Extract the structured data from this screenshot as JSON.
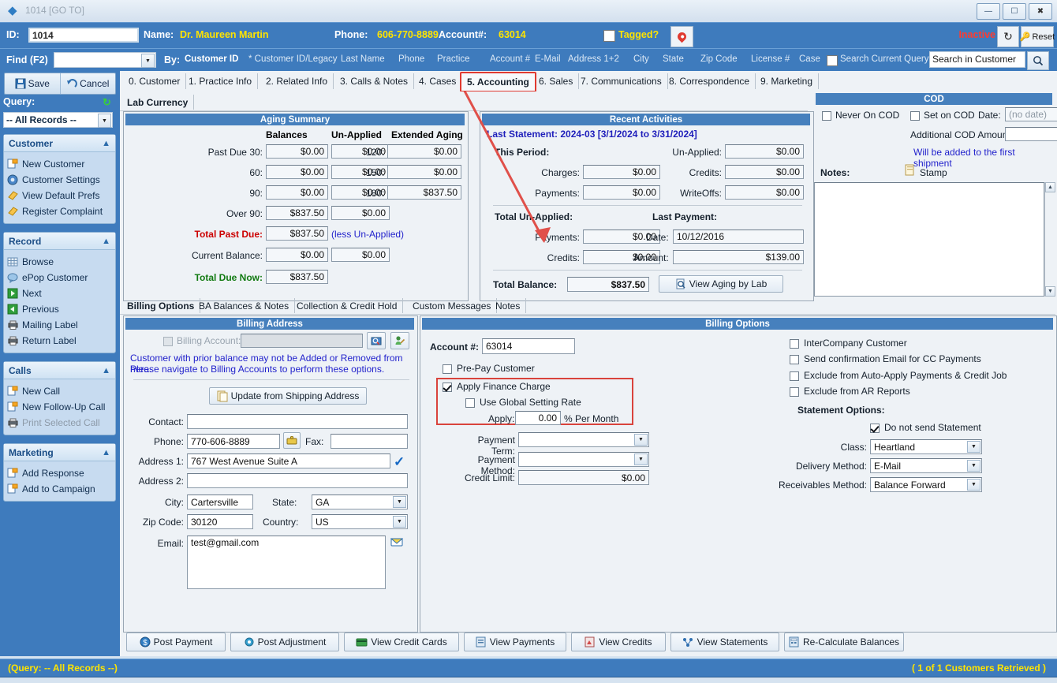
{
  "window": {
    "title": "1014 [GO TO]",
    "minimize": "—",
    "maximize": "❐",
    "close": "✕"
  },
  "header": {
    "id_label": "ID:",
    "id_value": "1014",
    "name_label": "Name:",
    "name_value": "Dr. Maureen Martin",
    "phone_label": "Phone:",
    "phone_value": "606-770-8889",
    "account_label": "Account#:",
    "account_value": "63014",
    "tagged_label": "Tagged?",
    "status": "Inactive",
    "reset_label": "Reset"
  },
  "findbar": {
    "find_label": "Find (F2)",
    "find_value": "",
    "by_label": "By:",
    "by_items": [
      {
        "label": "Customer ID",
        "current": true
      },
      {
        "label": "* Customer ID/Legacy",
        "current": false
      },
      {
        "label": "Last Name",
        "current": false
      },
      {
        "label": "Phone",
        "current": false
      },
      {
        "label": "Practice",
        "current": false
      },
      {
        "label": "Account #",
        "current": false
      },
      {
        "label": "E-Mail",
        "current": false
      },
      {
        "label": "Address 1+2",
        "current": false
      },
      {
        "label": "City",
        "current": false
      },
      {
        "label": "State",
        "current": false
      },
      {
        "label": "Zip Code",
        "current": false
      },
      {
        "label": "License #",
        "current": false
      },
      {
        "label": "Case",
        "current": false
      }
    ],
    "search_current_query": "Search Current Query",
    "search_value": "Search in Customer"
  },
  "sidebar": {
    "save_label": "Save",
    "cancel_label": "Cancel",
    "query_label": "Query:",
    "query_value": "-- All Records --",
    "groups": [
      {
        "title": "Customer",
        "items": [
          {
            "label": "New Customer",
            "icon": "new-document-icon",
            "disabled": false
          },
          {
            "label": "Customer Settings",
            "icon": "gear-ball-icon",
            "disabled": false
          },
          {
            "label": "View Default Prefs",
            "icon": "prefs-icon",
            "disabled": false
          },
          {
            "label": "Register Complaint",
            "icon": "prefs-icon",
            "disabled": false
          }
        ]
      },
      {
        "title": "Record",
        "items": [
          {
            "label": "Browse",
            "icon": "grid-icon",
            "disabled": false
          },
          {
            "label": "ePop Customer",
            "icon": "bubble-icon",
            "disabled": false
          },
          {
            "label": "Next",
            "icon": "next-icon",
            "disabled": false
          },
          {
            "label": "Previous",
            "icon": "previous-icon",
            "disabled": false
          },
          {
            "label": "Mailing Label",
            "icon": "printer-icon",
            "disabled": false
          },
          {
            "label": "Return Label",
            "icon": "printer-icon",
            "disabled": false
          }
        ]
      },
      {
        "title": "Calls",
        "items": [
          {
            "label": "New Call",
            "icon": "new-document-icon",
            "disabled": false
          },
          {
            "label": "New Follow-Up Call",
            "icon": "new-document-icon",
            "disabled": false
          },
          {
            "label": "Print Selected Call",
            "icon": "printer-icon",
            "disabled": true
          }
        ]
      },
      {
        "title": "Marketing",
        "items": [
          {
            "label": "Add Response",
            "icon": "new-document-icon",
            "disabled": false
          },
          {
            "label": "Add to Campaign",
            "icon": "new-document-icon",
            "disabled": false
          }
        ]
      }
    ]
  },
  "main_tabs": [
    {
      "label": "0. Customer",
      "active": false
    },
    {
      "label": "1. Practice Info",
      "active": false
    },
    {
      "label": "2. Related Info",
      "active": false
    },
    {
      "label": "3. Calls & Notes",
      "active": false
    },
    {
      "label": "4. Cases",
      "active": false
    },
    {
      "label": "5. Accounting",
      "active": true
    },
    {
      "label": "6. Sales",
      "active": false
    },
    {
      "label": "7. Communications",
      "active": false
    },
    {
      "label": "8. Correspondence",
      "active": false
    },
    {
      "label": "9. Marketing",
      "active": false
    }
  ],
  "currency_tabs": [
    {
      "label": "Lab Currency",
      "active": true
    }
  ],
  "aging": {
    "title": "Aging Summary",
    "col_balances": "Balances",
    "col_unapplied": "Un-Applied",
    "col_extended": "Extended Aging",
    "rows": [
      {
        "label": "Past Due 30:",
        "balance": "$0.00",
        "unapplied": "$0.00"
      },
      {
        "label": "60:",
        "balance": "$0.00",
        "unapplied": "$0.00"
      },
      {
        "label": "90:",
        "balance": "$0.00",
        "unapplied": "$0.00"
      },
      {
        "label": "Over 90:",
        "balance": "$837.50",
        "unapplied": "$0.00"
      }
    ],
    "extended_rows": [
      {
        "label": "120:",
        "value": "$0.00"
      },
      {
        "label": "150:",
        "value": "$0.00"
      },
      {
        "label": "180:",
        "value": "$837.50"
      }
    ],
    "total_past_due_label": "Total Past Due:",
    "total_past_due_value": "$837.50",
    "less_unapplied": "(less Un-Applied)",
    "current_balance_label": "Current Balance:",
    "current_balance_value": "$0.00",
    "current_balance_unapplied": "$0.00",
    "total_due_now_label": "Total Due Now:",
    "total_due_now_value": "$837.50"
  },
  "recent": {
    "title": "Recent Activities",
    "last_statement": "Last Statement: 2024-03  [3/1/2024 to 3/31/2024]",
    "this_period_label": "This Period:",
    "charges_label": "Charges:",
    "charges_value": "$0.00",
    "payments_label": "Payments:",
    "payments_value": "$0.00",
    "unapplied_label": "Un-Applied:",
    "unapplied_value": "$0.00",
    "credits_label": "Credits:",
    "credits_value": "$0.00",
    "writeoffs_label": "WriteOffs:",
    "writeoffs_value": "$0.00",
    "total_unapplied_label": "Total Un-Applied:",
    "tu_payments_label": "Payments:",
    "tu_payments_value": "$0.00",
    "tu_credits_label": "Credits:",
    "tu_credits_value": "$0.00",
    "last_payment_label": "Last Payment:",
    "lp_date_label": "Date:",
    "lp_date_value": "10/12/2016",
    "lp_amount_label": "Amount:",
    "lp_amount_value": "$139.00",
    "total_balance_label": "Total Balance:",
    "total_balance_value": "$837.50",
    "view_aging_btn": "View Aging by Lab"
  },
  "cod": {
    "title": "COD",
    "never_on_cod": "Never On COD",
    "set_on_cod": "Set on COD",
    "date_label": "Date:",
    "date_value": "(no date)",
    "additional_label": "Additional COD Amount:",
    "additional_value": "",
    "note": "Will be added to the first shipment",
    "notes_label": "Notes:",
    "stamp_label": "Stamp",
    "notes_value": ""
  },
  "billing_tabs": [
    {
      "label": "Billing Options",
      "active": true
    },
    {
      "label": "BA Balances & Notes",
      "active": false
    },
    {
      "label": "Collection & Credit Hold",
      "active": false
    },
    {
      "label": "Custom Messages",
      "active": false
    },
    {
      "label": "Notes",
      "active": false
    }
  ],
  "billing_address": {
    "title": "Billing Address",
    "billing_account_label": "Billing Account:",
    "billing_account_value": "",
    "warning_line1": "Customer with prior balance may not be Added or Removed from here.",
    "warning_line2": "Please navigate to Billing Accounts to perform these options.",
    "update_btn": "Update from Shipping Address",
    "contact_label": "Contact:",
    "contact_value": "",
    "phone_label": "Phone:",
    "phone_value": "770-606-8889",
    "fax_label": "Fax:",
    "fax_value": "",
    "address1_label": "Address 1:",
    "address1_value": "767 West Avenue Suite A",
    "address2_label": "Address 2:",
    "address2_value": "",
    "city_label": "City:",
    "city_value": "Cartersville",
    "state_label": "State:",
    "state_value": "GA",
    "zip_label": "Zip Code:",
    "zip_value": "30120",
    "country_label": "Country:",
    "country_value": "US",
    "email_label": "Email:",
    "email_value": "test@gmail.com"
  },
  "billing_options": {
    "title": "Billing Options",
    "account_label": "Account #:",
    "account_value": "63014",
    "prepay_label": "Pre-Pay Customer",
    "prepay_checked": false,
    "apply_finance_label": "Apply Finance Charge",
    "apply_finance_checked": true,
    "global_rate_label": "Use Global Setting Rate",
    "global_rate_checked": false,
    "apply_label": "Apply:",
    "apply_value": "0.00",
    "apply_suffix": "% Per Month",
    "payment_term_label": "Payment Term:",
    "payment_term_value": "",
    "payment_method_label": "Payment Method:",
    "payment_method_value": "",
    "credit_limit_label": "Credit Limit:",
    "credit_limit_value": "$0.00",
    "checks": [
      {
        "label": "InterCompany Customer",
        "checked": false
      },
      {
        "label": "Send confirmation Email for CC Payments",
        "checked": false
      },
      {
        "label": "Exclude from Auto-Apply Payments & Credit Job",
        "checked": false
      },
      {
        "label": "Exclude from AR Reports",
        "checked": false
      }
    ],
    "statement_options_label": "Statement Options:",
    "do_not_send_label": "Do not send Statement",
    "do_not_send_checked": true,
    "class_label": "Class:",
    "class_value": "Heartland",
    "delivery_label": "Delivery Method:",
    "delivery_value": "E-Mail",
    "receivables_label": "Receivables Method:",
    "receivables_value": "Balance Forward"
  },
  "bottom_buttons": [
    {
      "label": "Post Payment",
      "icon": "payment-icon"
    },
    {
      "label": "Post Adjustment",
      "icon": "adjustment-icon"
    },
    {
      "label": "View Credit Cards",
      "icon": "credit-card-icon"
    },
    {
      "label": "View Payments",
      "icon": "payments-icon"
    },
    {
      "label": "View Credits",
      "icon": "credits-icon"
    },
    {
      "label": "View Statements",
      "icon": "statements-icon"
    },
    {
      "label": "Re-Calculate Balances",
      "icon": "recalculate-icon"
    }
  ],
  "status": {
    "left": "(Query: -- All Records --)",
    "right": "( 1 of 1 Customers Retrieved )"
  },
  "colors": {
    "accent_blue": "#3e7bbd",
    "panel_header": "#4680bd",
    "highlight_red": "#d9433c",
    "value_yellow": "#ffe400",
    "inactive_red": "#ff3b30",
    "link_blue": "#2222cc",
    "green": "#117a11"
  }
}
